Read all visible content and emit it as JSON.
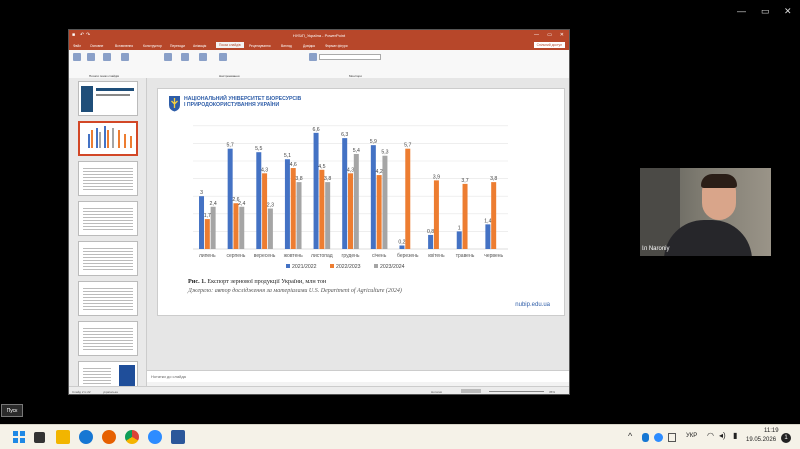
{
  "outer_window": {
    "controls": [
      "—",
      "▭",
      "✕"
    ]
  },
  "ppt": {
    "title": "НУБіП_Україна - PowerPoint",
    "tabs": [
      "Файл",
      "Основне",
      "Вставлення",
      "Конструктор",
      "Переходи",
      "Анімація",
      "Показ слайдів",
      "Рецензування",
      "Вигляд",
      "Довідка",
      "Формат фігури"
    ],
    "active_tab": "Показ слайдів",
    "share_label": "Спільний доступ",
    "ribbon_groups": [
      "Почати показ слайдів",
      "Настроювання",
      "Монітори"
    ],
    "notes_placeholder": "Нотатки до слайда",
    "status_left": "Слайд 2 із 22",
    "status_lang": "українська",
    "status_notes": "Нотатки",
    "zoom": "35%",
    "thumbs_count": 8
  },
  "slide": {
    "university_line1": "НАЦІОНАЛЬНИЙ УНІВЕРСИТЕТ БІОРЕСУРСІВ",
    "university_line2": "І ПРИРОДОКОРИСТУВАННЯ УКРАЇНИ",
    "caption_bold": "Рис. 1.",
    "caption_text": " Експорт зернової продукції України, млн тон",
    "source_label": "Джерело:",
    "source_text": " автор дослідження за матеріалами U.S. Department of Agriculture (2024)",
    "website": "nubip.edu.ua"
  },
  "chart_data": {
    "type": "bar",
    "categories": [
      "липень",
      "серпень",
      "вересень",
      "жовтень",
      "листопад",
      "грудень",
      "січень",
      "березень",
      "квітень",
      "травень",
      "червень"
    ],
    "series": [
      {
        "name": "2021/2022",
        "color": "#4472c4",
        "values": [
          3,
          5.7,
          5.5,
          5.1,
          6.6,
          6.3,
          5.9,
          0.2,
          0.8,
          1,
          1.4
        ]
      },
      {
        "name": "2022/2023",
        "color": "#ed7d31",
        "values": [
          1.7,
          2.6,
          4.3,
          4.6,
          4.5,
          4.3,
          4.2,
          5.7,
          3.9,
          3.7,
          3.8
        ]
      },
      {
        "name": "2023/2024",
        "color": "#a5a5a5",
        "values": [
          2.4,
          2.4,
          2.3,
          3.8,
          3.8,
          5.4,
          5.3,
          null,
          null,
          null,
          null
        ]
      }
    ],
    "ylim": [
      0,
      7.5
    ],
    "legend": "bottom",
    "grid": true
  },
  "webcam": {
    "name_label": "Іл Naroniy"
  },
  "tooltip": "Пуск",
  "taskbar": {
    "lang": "УКР",
    "time": "11:19",
    "date": "19.05.2026",
    "notification_count": "1"
  }
}
